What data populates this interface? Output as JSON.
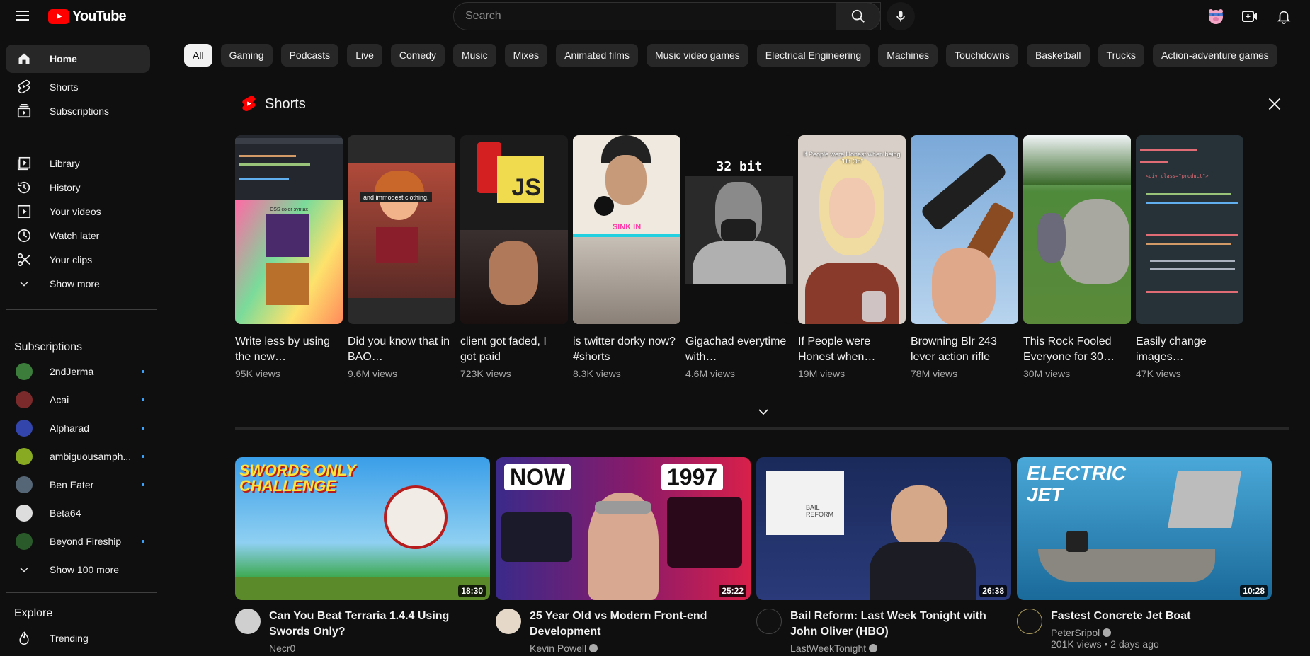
{
  "header": {
    "logo_text": "YouTube",
    "search_placeholder": "Search"
  },
  "sidebar": {
    "main": [
      {
        "label": "Home",
        "icon": "home-icon",
        "active": true
      },
      {
        "label": "Shorts",
        "icon": "shorts-icon"
      },
      {
        "label": "Subscriptions",
        "icon": "subscriptions-icon"
      }
    ],
    "you": [
      {
        "label": "Library",
        "icon": "library-icon"
      },
      {
        "label": "History",
        "icon": "history-icon"
      },
      {
        "label": "Your videos",
        "icon": "your-videos-icon"
      },
      {
        "label": "Watch later",
        "icon": "clock-icon"
      },
      {
        "label": "Your clips",
        "icon": "scissors-icon"
      },
      {
        "label": "Show more",
        "icon": "chevron-down-icon"
      }
    ],
    "subscriptions_title": "Subscriptions",
    "subscriptions": [
      {
        "name": "2ndJerma",
        "live": true,
        "color": "#3c7d3c"
      },
      {
        "name": "Acai",
        "live": true,
        "color": "#7a2a2a"
      },
      {
        "name": "Alpharad",
        "live": true,
        "color": "#3344aa"
      },
      {
        "name": "ambiguousamph...",
        "live": true,
        "color": "#88aa22"
      },
      {
        "name": "Ben Eater",
        "live": true,
        "color": "#556677"
      },
      {
        "name": "Beta64",
        "live": false,
        "color": "#dddddd"
      },
      {
        "name": "Beyond Fireship",
        "live": true,
        "color": "#2a5a2a"
      }
    ],
    "show_more_subs": "Show 100 more",
    "explore_title": "Explore",
    "explore": [
      {
        "label": "Trending",
        "icon": "trending-icon"
      }
    ]
  },
  "chips": [
    "All",
    "Gaming",
    "Podcasts",
    "Live",
    "Comedy",
    "Music",
    "Mixes",
    "Animated films",
    "Music video games",
    "Electrical Engineering",
    "Machines",
    "Touchdowns",
    "Basketball",
    "Trucks",
    "Action-adventure games"
  ],
  "shorts": {
    "title": "Shorts",
    "items": [
      {
        "title": "Write less by using the new…",
        "views": "95K views",
        "thumb_text": "CSS color syntax"
      },
      {
        "title": "Did you know that in BAO…",
        "views": "9.6M views",
        "thumb_text": "and immodest clothing."
      },
      {
        "title": "client got faded, I got paid",
        "views": "723K views",
        "thumb_text": "JS"
      },
      {
        "title": "is twitter dorky now? #shorts",
        "views": "8.3K views",
        "thumb_text": "SINK IN"
      },
      {
        "title": "Gigachad everytime with…",
        "views": "4.6M views",
        "thumb_text": "32 bit"
      },
      {
        "title": "If People were Honest when…",
        "views": "19M views",
        "thumb_text": "If People were Honest when being \"Hit On\""
      },
      {
        "title": "Browning Blr 243 lever action rifle",
        "views": "78M views",
        "thumb_text": ""
      },
      {
        "title": "This Rock Fooled Everyone for 30…",
        "views": "30M views",
        "thumb_text": ""
      },
      {
        "title": "Easily change images…",
        "views": "47K views",
        "thumb_text": "<div class=\"product\">"
      }
    ]
  },
  "videos": [
    {
      "title": "Can You Beat Terraria 1.4.4 Using Swords Only?",
      "channel": "Necr0",
      "verified": false,
      "stats": "",
      "duration": "18:30",
      "thumb_text": "SWORDS ONLY CHALLENGE"
    },
    {
      "title": "25 Year Old vs Modern Front-end Development",
      "channel": "Kevin Powell",
      "verified": true,
      "stats": "",
      "duration": "25:22",
      "thumb_text_left": "NOW",
      "thumb_text_right": "1997"
    },
    {
      "title": "Bail Reform: Last Week Tonight with John Oliver (HBO)",
      "channel": "LastWeekTonight",
      "verified": true,
      "stats": "",
      "duration": "26:38",
      "thumb_text": "BAIL REFORM"
    },
    {
      "title": "Fastest Concrete Jet Boat",
      "channel": "PeterSripol",
      "verified": true,
      "stats": "201K views • 2 days ago",
      "duration": "10:28",
      "thumb_text": "ELECTRIC JET"
    }
  ]
}
